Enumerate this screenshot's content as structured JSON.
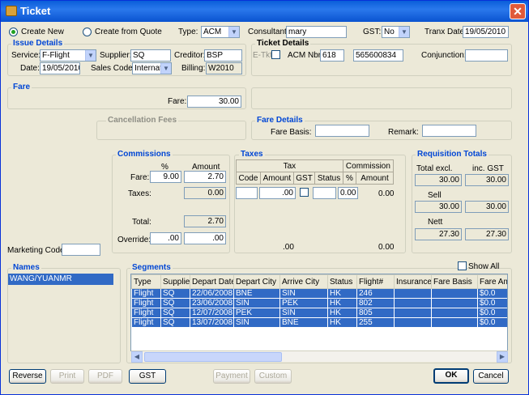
{
  "window": {
    "title": "Ticket",
    "close_glyph": "✕"
  },
  "top": {
    "create_new": "Create New",
    "create_from_quote": "Create from Quote",
    "type_label": "Type:",
    "type_value": "ACM",
    "consultant_label": "Consultant:",
    "consultant_value": "mary",
    "gst_label": "GST:",
    "gst_value": "No",
    "tranx_date_label": "Tranx Date:",
    "tranx_date_value": "19/05/2010"
  },
  "issue": {
    "title": "Issue Details",
    "service_label": "Service:",
    "service_value": "F-Flight",
    "supplier_label": "Supplier:",
    "supplier_value": "SQ",
    "creditor_label": "Creditor:",
    "creditor_value": "BSP",
    "date_label": "Date:",
    "date_value": "19/05/2010",
    "sales_code_label": "Sales Code:",
    "sales_code_value": "Internat",
    "billing_label": "Billing:",
    "billing_value": "W2010"
  },
  "ticket": {
    "title": "Ticket Details",
    "etkt_label": "E-Tkt",
    "acm_label": "ACM Nbr:",
    "acm_value1": "618",
    "acm_value2": "565600834",
    "conjunction_label": "Conjunction:",
    "conjunction_value": ""
  },
  "fare": {
    "title": "Fare",
    "fare_label": "Fare:",
    "fare_value": "30.00"
  },
  "cancellation": {
    "title": "Cancellation Fees"
  },
  "fare_details": {
    "title": "Fare Details",
    "fare_basis_label": "Fare Basis:",
    "fare_basis_value": "",
    "remark_label": "Remark:",
    "remark_value": ""
  },
  "commissions": {
    "title": "Commissions",
    "pct_header": "%",
    "amount_header": "Amount",
    "fare_label": "Fare:",
    "fare_pct": "9.00",
    "fare_amount": "2.70",
    "taxes_label": "Taxes:",
    "taxes_amount": "0.00",
    "total_label": "Total:",
    "total_amount": "2.70",
    "override_label": "Override:",
    "override_pct": ".00",
    "override_amount": ".00"
  },
  "taxes": {
    "title": "Taxes",
    "tax_header": "Tax",
    "commission_header": "Commission",
    "cols": [
      "Code",
      "Amount",
      "GST",
      "Status",
      "%",
      "Amount"
    ],
    "row_amount": ".00",
    "row_pct": "0.00",
    "row_comm_amount": "0.00",
    "total_amount": ".00",
    "total_comm": "0.00"
  },
  "requisition": {
    "title": "Requisition Totals",
    "excl_label": "Total excl.",
    "inc_label": "inc. GST",
    "total_excl": "30.00",
    "total_inc": "30.00",
    "sell_label": "Sell",
    "sell_excl": "30.00",
    "sell_inc": "30.00",
    "nett_label": "Nett",
    "nett_excl": "27.30",
    "nett_inc": "27.30"
  },
  "marketing": {
    "label": "Marketing Code:",
    "value": ""
  },
  "names": {
    "title": "Names",
    "items": [
      "WANG/YUANMR"
    ]
  },
  "segments": {
    "title": "Segments",
    "show_all": "Show All",
    "columns": [
      "Type",
      "Supplier",
      "Depart Date",
      "Depart City",
      "Arrive City",
      "Status",
      "Flight#",
      "Insurance",
      "Fare Basis",
      "Fare Amount"
    ],
    "rows": [
      [
        "Flight",
        "SQ",
        "22/06/2008",
        "BNE",
        "SIN",
        "HK",
        "246",
        "",
        "",
        "$0.0"
      ],
      [
        "Flight",
        "SQ",
        "23/06/2008",
        "SIN",
        "PEK",
        "HK",
        "802",
        "",
        "",
        "$0.0"
      ],
      [
        "Flight",
        "SQ",
        "12/07/2008",
        "PEK",
        "SIN",
        "HK",
        "805",
        "",
        "",
        "$0.0"
      ],
      [
        "Flight",
        "SQ",
        "13/07/2008",
        "SIN",
        "BNE",
        "HK",
        "255",
        "",
        "",
        "$0.0"
      ]
    ]
  },
  "buttons": {
    "reverse": "Reverse",
    "print": "Print",
    "pdf": "PDF",
    "gst": "GST",
    "payment": "Payment",
    "custom": "Custom",
    "ok": "OK",
    "cancel": "Cancel"
  }
}
